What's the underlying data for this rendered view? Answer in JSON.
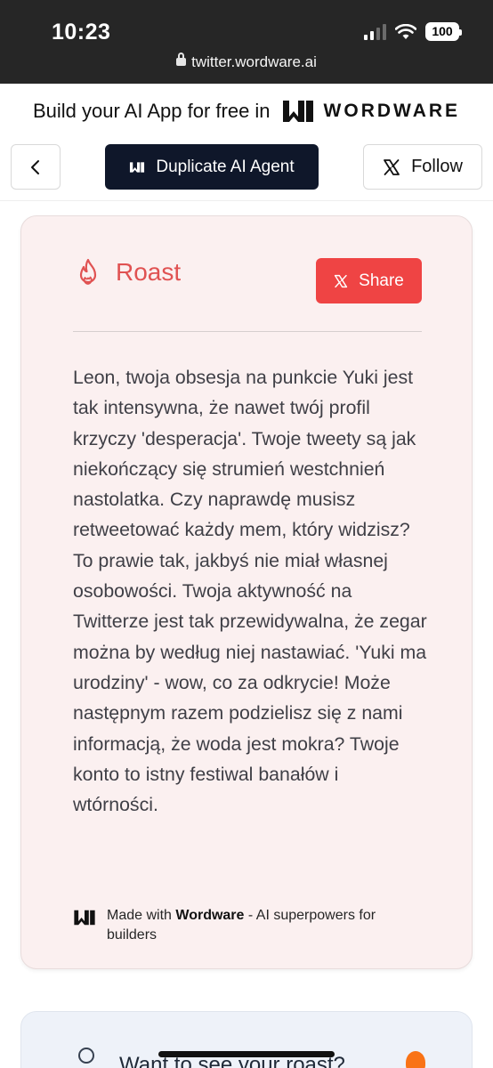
{
  "status_bar": {
    "time": "10:23",
    "battery": "100",
    "url": "twitter.wordware.ai"
  },
  "promo": {
    "text": "Build your AI App for free in",
    "brand": "WORDWARE"
  },
  "nav": {
    "duplicate_label": "Duplicate AI Agent",
    "follow_label": "Follow"
  },
  "roast": {
    "title": "Roast",
    "share_label": "Share",
    "text": "Leon, twoja obsesja na punkcie Yuki jest tak intensywna, że nawet twój profil krzyczy 'desperacja'. Twoje tweety są jak niekończący się strumień westchnień nastolatka. Czy naprawdę musisz retweetować każdy mem, który widzisz? To prawie tak, jakbyś nie miał własnej osobowości. Twoja aktywność na Twitterze jest tak przewidywalna, że zegar można by według niej nastawiać. 'Yuki ma urodziny' - wow, co za odkrycie! Może następnym razem podzielisz się z nami informacją, że woda jest mokra? Twoje konto to istny festiwal banałów i wtórności.",
    "made_with_prefix": "Made with",
    "made_with_brand": "Wordware",
    "made_with_suffix": " - AI superpowers for builders"
  },
  "next_card": {
    "title": "Want to see your roast?"
  },
  "colors": {
    "accent": "#ef4444",
    "dark_button": "#0f172a",
    "card_bg": "#fbf0f0"
  },
  "icons": {
    "back": "chevron-left-icon",
    "duplicate": "wordware-logo-icon",
    "x": "x-logo-icon",
    "roast": "flame-icon"
  }
}
